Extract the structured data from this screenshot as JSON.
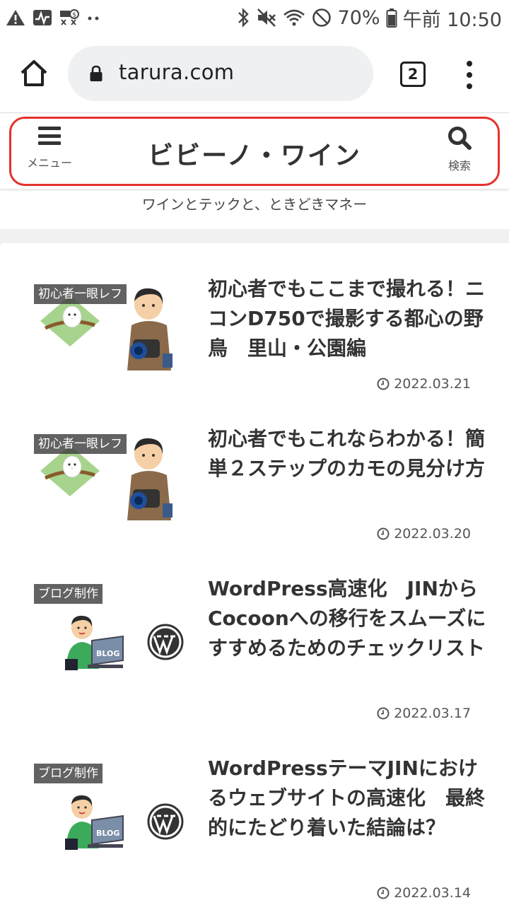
{
  "status_bar": {
    "battery": "70%",
    "time": "午前 10:50"
  },
  "browser": {
    "url": "tarura.com",
    "tab_count": "2"
  },
  "site": {
    "menu_label": "メニュー",
    "title": "ビビーノ・ワイン",
    "search_label": "検索",
    "tagline": "ワインとテックと、ときどきマネー",
    "highlight_color": "#e5322d"
  },
  "posts": [
    {
      "category": "初心者一眼レフ",
      "title": "初心者でもここまで撮れる！ニコンD750で撮影する都心の野鳥　里山・公園編",
      "date": "2022.03.21",
      "thumb_icons": [
        "bird-icon",
        "photographer-icon"
      ]
    },
    {
      "category": "初心者一眼レフ",
      "title": "初心者でもこれならわかる！簡単２ステップのカモの見分け方",
      "date": "2022.03.20",
      "thumb_icons": [
        "bird-icon",
        "photographer-icon"
      ]
    },
    {
      "category": "ブログ制作",
      "title": "WordPress高速化　JINからCocoonへの移行をスムーズにすすめるためのチェックリスト",
      "date": "2022.03.17",
      "thumb_icons": [
        "blogger-icon",
        "wordpress-logo-icon"
      ],
      "blog_badge": "BLOG"
    },
    {
      "category": "ブログ制作",
      "title": "WordPressテーマJINにおけるウェブサイトの高速化　最終的にたどり着いた結論は？",
      "date": "2022.03.14",
      "thumb_icons": [
        "blogger-icon",
        "wordpress-logo-icon"
      ],
      "blog_badge": "BLOG"
    }
  ]
}
